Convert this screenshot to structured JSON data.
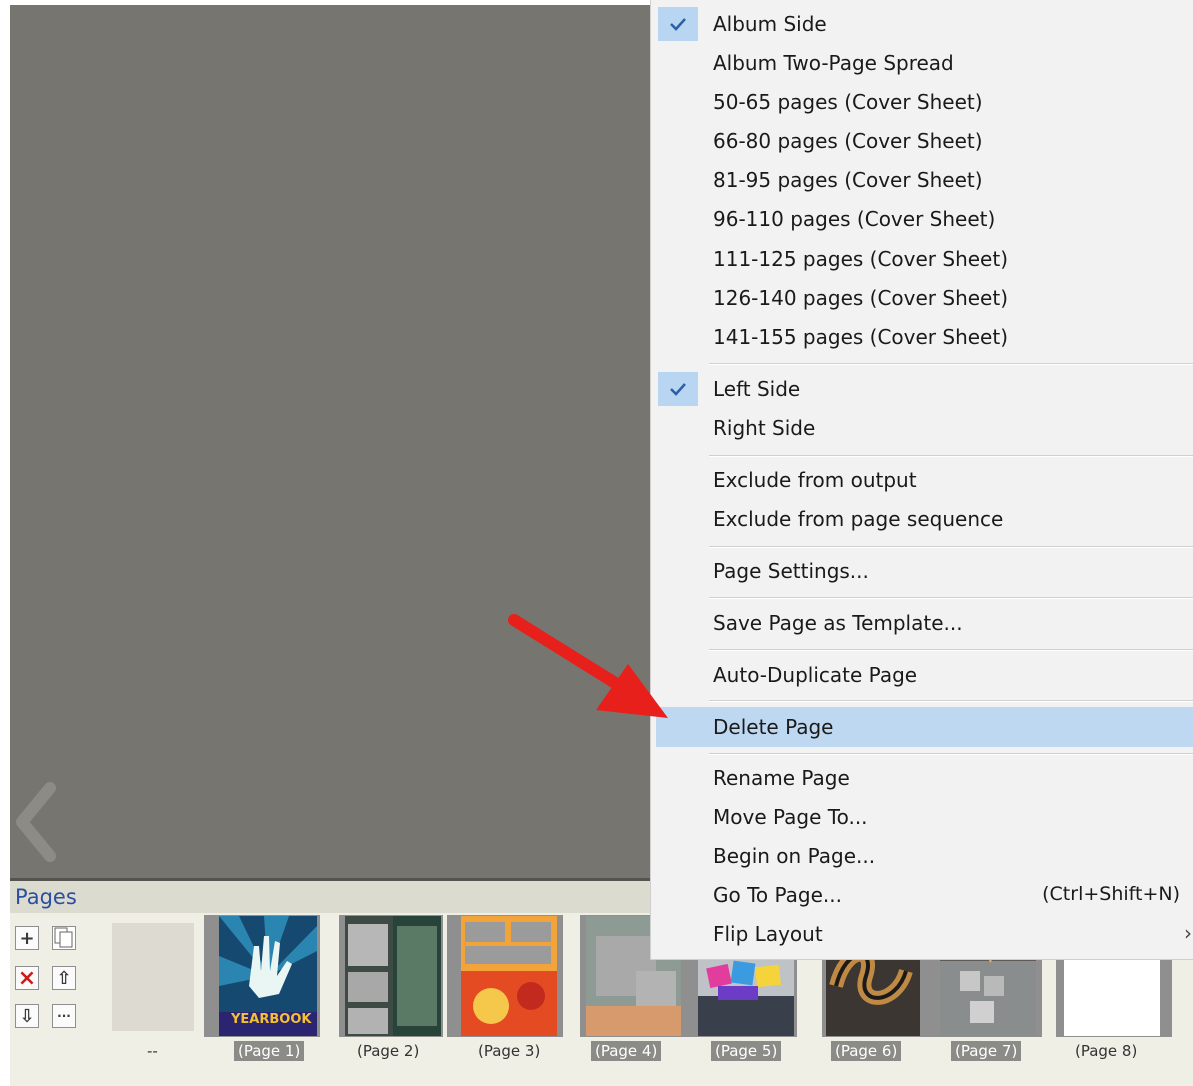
{
  "pages_panel": {
    "title": "Pages",
    "toolbar": [
      {
        "icon": "add-page-icon",
        "symbol": "+"
      },
      {
        "icon": "copy-page-icon",
        "symbol": ""
      },
      {
        "icon": "delete-page-icon",
        "symbol": "×"
      },
      {
        "icon": "move-up-icon",
        "symbol": "⇧"
      },
      {
        "icon": "move-down-icon",
        "symbol": "⇩"
      },
      {
        "icon": "more-options-icon",
        "symbol": "···"
      }
    ],
    "thumbnails": [
      {
        "label": "--"
      },
      {
        "label": "(Page 1)"
      },
      {
        "label": "(Page 2)"
      },
      {
        "label": "(Page 3)"
      },
      {
        "label": "(Page 4)"
      },
      {
        "label": "(Page 5)"
      },
      {
        "label": "(Page 6)"
      },
      {
        "label": "(Page 7)"
      },
      {
        "label": "(Page 8)"
      }
    ],
    "yearbook_text": "YEARBOOK"
  },
  "context_menu": {
    "items": [
      {
        "label": "Album Side",
        "checked": true
      },
      {
        "label": "Album Two-Page Spread"
      },
      {
        "label": "50-65 pages (Cover Sheet)"
      },
      {
        "label": "66-80 pages (Cover Sheet)"
      },
      {
        "label": "81-95 pages (Cover Sheet)"
      },
      {
        "label": "96-110 pages (Cover Sheet)"
      },
      {
        "label": "111-125 pages (Cover Sheet)"
      },
      {
        "label": "126-140 pages (Cover Sheet)"
      },
      {
        "label": "141-155 pages (Cover Sheet)"
      },
      {
        "label": "Left Side",
        "checked": true
      },
      {
        "label": "Right Side"
      },
      {
        "label": "Exclude from output"
      },
      {
        "label": "Exclude from page sequence"
      },
      {
        "label": "Page Settings..."
      },
      {
        "label": "Save Page as Template..."
      },
      {
        "label": "Auto-Duplicate Page"
      },
      {
        "label": "Delete Page",
        "highlighted": true
      },
      {
        "label": "Rename Page"
      },
      {
        "label": "Move Page To..."
      },
      {
        "label": "Begin on Page..."
      },
      {
        "label": "Go To Page...",
        "shortcut": "(Ctrl+Shift+N)"
      },
      {
        "label": "Flip Layout",
        "submenu_arrow": "›"
      }
    ]
  },
  "colors": {
    "canvas": "#777570",
    "menu_highlight": "#bed8f2",
    "check_bg": "#b8d6f1",
    "arrow": "#e8201c",
    "pages_title": "#2a4ea0"
  }
}
